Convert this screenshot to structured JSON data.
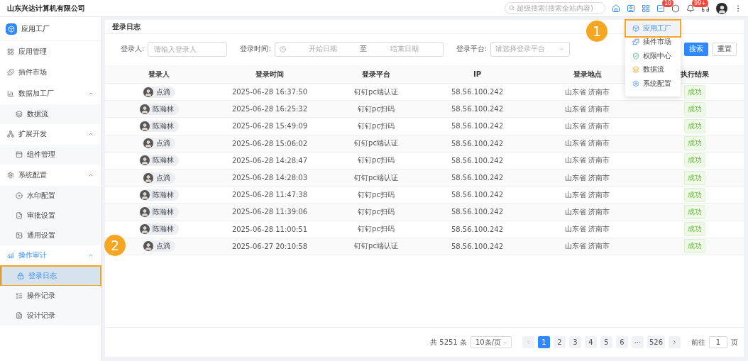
{
  "topbar": {
    "company": "山东兴达计算机有限公司",
    "search": {
      "placeholder": "超级搜索(搜索全站内容)"
    },
    "task_badge": "10",
    "notice_badge": "99+"
  },
  "sidebar": {
    "title": "应用工厂",
    "items": [
      {
        "label": "应用管理",
        "selected": false,
        "highlighted": false
      },
      {
        "label": "插件市场",
        "selected": false,
        "highlighted": false
      },
      {
        "label": "数据加工厂",
        "selected": false,
        "highlighted": false,
        "expanded": true,
        "children": [
          {
            "label": "数据流",
            "selected": false,
            "highlighted": false
          }
        ]
      },
      {
        "label": "扩展开发",
        "selected": false,
        "highlighted": false,
        "expanded": true,
        "children": [
          {
            "label": "组件管理",
            "selected": false,
            "highlighted": false
          }
        ]
      },
      {
        "label": "系统配置",
        "selected": false,
        "highlighted": false,
        "expanded": true,
        "children": [
          {
            "label": "水印配置",
            "selected": false,
            "highlighted": false
          },
          {
            "label": "审批设置",
            "selected": false,
            "highlighted": false
          },
          {
            "label": "通用设置",
            "selected": false,
            "highlighted": false
          }
        ]
      },
      {
        "label": "操作审计",
        "selected": false,
        "highlighted": false,
        "expanded": true,
        "children": [
          {
            "label": "登录日志",
            "selected": true,
            "highlighted": true
          },
          {
            "label": "操作记录",
            "selected": false,
            "highlighted": false
          },
          {
            "label": "设计记录",
            "selected": false,
            "highlighted": false
          }
        ]
      }
    ]
  },
  "page": {
    "title": "登录日志",
    "filters": [
      {
        "kind": "input",
        "label": "登录人:",
        "placeholder": "请输入登录人"
      },
      {
        "kind": "daterange",
        "label": "登录时间:",
        "start_placeholder": "开始日期",
        "separator": "至",
        "end_placeholder": "结束日期"
      },
      {
        "kind": "select",
        "label": "登录平台:",
        "placeholder": "请选择登录平台"
      }
    ],
    "buttons": [
      {
        "label": "搜索",
        "primary": true
      },
      {
        "label": "重置",
        "primary": false
      }
    ],
    "table": {
      "columns": [
        "登录人",
        "登录时间",
        "登录平台",
        "IP",
        "登录地点",
        "执行结果"
      ],
      "rows": [
        {
          "user": "点滴",
          "time": "2025-06-28 16:37:50",
          "platform": "钉钉pc端认证",
          "ip": "58.56.100.242",
          "location": "山东省 济南市",
          "result": "成功"
        },
        {
          "user": "陈瀚林",
          "time": "2025-06-28 16:25:32",
          "platform": "钉钉pc扫码",
          "ip": "58.56.100.242",
          "location": "山东省 济南市",
          "result": "成功"
        },
        {
          "user": "陈瀚林",
          "time": "2025-06-28 15:49:09",
          "platform": "钉钉pc扫码",
          "ip": "58.56.100.242",
          "location": "山东省 济南市",
          "result": "成功"
        },
        {
          "user": "点滴",
          "time": "2025-06-28 15:06:02",
          "platform": "钉钉pc端认证",
          "ip": "58.56.100.242",
          "location": "山东省 济南市",
          "result": "成功"
        },
        {
          "user": "陈瀚林",
          "time": "2025-06-28 14:28:47",
          "platform": "钉钉pc扫码",
          "ip": "58.56.100.242",
          "location": "山东省 济南市",
          "result": "成功"
        },
        {
          "user": "点滴",
          "time": "2025-06-28 14:28:03",
          "platform": "钉钉pc端认证",
          "ip": "58.56.100.242",
          "location": "山东省 济南市",
          "result": "成功"
        },
        {
          "user": "陈瀚林",
          "time": "2025-06-28 11:47:38",
          "platform": "钉钉pc扫码",
          "ip": "58.56.100.242",
          "location": "山东省 济南市",
          "result": "成功"
        },
        {
          "user": "陈瀚林",
          "time": "2025-06-28 11:39:06",
          "platform": "钉钉pc扫码",
          "ip": "58.56.100.242",
          "location": "山东省 济南市",
          "result": "成功"
        },
        {
          "user": "陈瀚林",
          "time": "2025-06-28 11:00:51",
          "platform": "钉钉pc扫码",
          "ip": "58.56.100.242",
          "location": "山东省 济南市",
          "result": "成功"
        },
        {
          "user": "点滴",
          "time": "2025-06-27 20:10:58",
          "platform": "钉钉pc端认证",
          "ip": "58.56.100.242",
          "location": "山东省 济南市",
          "result": "成功"
        }
      ]
    },
    "pagination": {
      "total": "共 5251 条",
      "page_size": "10条/页",
      "pages": [
        {
          "label": "1",
          "selected": true
        },
        {
          "label": "2",
          "selected": false
        },
        {
          "label": "3",
          "selected": false
        },
        {
          "label": "4",
          "selected": false
        },
        {
          "label": "5",
          "selected": false
        },
        {
          "label": "6",
          "selected": false
        },
        {
          "label": "···",
          "selected": false
        },
        {
          "label": "526",
          "selected": false
        }
      ],
      "goto_label": "前往",
      "goto_value": "1",
      "goto_suffix": "页"
    }
  },
  "app_menu": {
    "items": [
      {
        "label": "应用工厂",
        "highlighted": true
      },
      {
        "label": "插件市场",
        "highlighted": false
      },
      {
        "label": "权限中心",
        "highlighted": false
      },
      {
        "label": "数据流",
        "highlighted": false
      },
      {
        "label": "系统配置",
        "highlighted": false
      }
    ]
  },
  "callouts": [
    {
      "label": "1"
    },
    {
      "label": "2"
    }
  ]
}
